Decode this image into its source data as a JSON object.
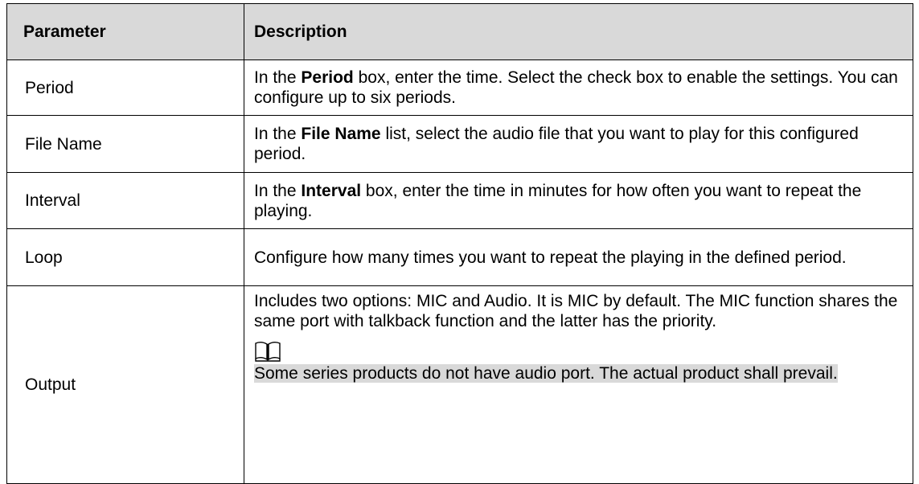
{
  "table": {
    "header": {
      "parameter": "Parameter",
      "description": "Description"
    },
    "rows": {
      "period": {
        "name": "Period",
        "desc_pre": "In the ",
        "desc_bold": "Period",
        "desc_post": " box, enter the time. Select the check box to enable the settings. You can configure up to six periods."
      },
      "file_name": {
        "name": "File Name",
        "desc_pre": "In the ",
        "desc_bold": "File Name",
        "desc_post": " list, select the audio file that you want to play for this configured period."
      },
      "interval": {
        "name": "Interval",
        "desc_pre": "In the ",
        "desc_bold": "Interval",
        "desc_post": " box, enter the time in minutes for how often you want to repeat the playing."
      },
      "loop": {
        "name": "Loop",
        "desc": "Configure how many times you want to repeat the playing in the defined period."
      },
      "output": {
        "name": "Output",
        "desc": "Includes two options: MIC and Audio. It is MIC by default. The MIC function shares the same port with talkback function and the latter has the priority.",
        "note_icon": "book-icon",
        "note": "Some series products do not have audio port. The actual product shall prevail."
      }
    }
  },
  "colors": {
    "header_background": "#d9d9d9",
    "note_highlight": "#d9d9d9",
    "border": "#000000"
  }
}
